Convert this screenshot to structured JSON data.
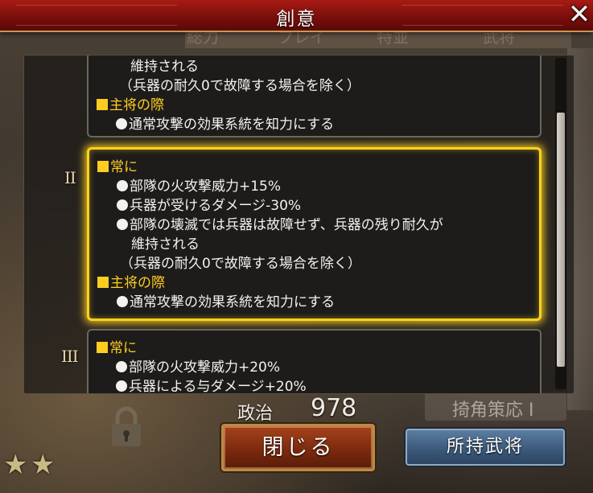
{
  "window": {
    "title": "創意",
    "close_glyph": "✕"
  },
  "background": {
    "tabs": [
      "総力",
      "プレイ",
      "特並",
      "武将"
    ],
    "stat_label": "政治",
    "stat_value": "978",
    "tag_label": "掎角策応",
    "tag_rank": "I"
  },
  "cards": [
    {
      "level": "",
      "lines": [
        {
          "kind": "text",
          "text": "維持される"
        },
        {
          "kind": "text",
          "text": "（兵器の耐久0で故障する場合を除く）"
        },
        {
          "kind": "head",
          "text": "主将の際"
        },
        {
          "kind": "bullet",
          "text": "通常攻撃の効果系統を知力にする"
        }
      ]
    },
    {
      "level": "II",
      "selected": true,
      "lines": [
        {
          "kind": "head",
          "text": "常に"
        },
        {
          "kind": "bullet",
          "text": "部隊の火攻撃威力+15%"
        },
        {
          "kind": "bullet",
          "text": "兵器が受けるダメージ-30%"
        },
        {
          "kind": "bullet",
          "text": "部隊の壊滅では兵器は故障せず、兵器の残り耐久が"
        },
        {
          "kind": "text",
          "text": "維持される"
        },
        {
          "kind": "text",
          "text": "（兵器の耐久0で故障する場合を除く）"
        },
        {
          "kind": "head",
          "text": "主将の際"
        },
        {
          "kind": "bullet",
          "text": "通常攻撃の効果系統を知力にする"
        }
      ]
    },
    {
      "level": "III",
      "lines": [
        {
          "kind": "head",
          "text": "常に"
        },
        {
          "kind": "bullet",
          "text": "部隊の火攻撃威力+20%"
        },
        {
          "kind": "bullet",
          "text": "兵器による与ダメージ+20%"
        }
      ]
    }
  ],
  "buttons": {
    "close_label": "閉じる",
    "owned_label": "所持武将"
  },
  "colors": {
    "accent_gold": "#ffcc22",
    "title_red": "#8a120e",
    "highlight": "#ffd21e"
  }
}
